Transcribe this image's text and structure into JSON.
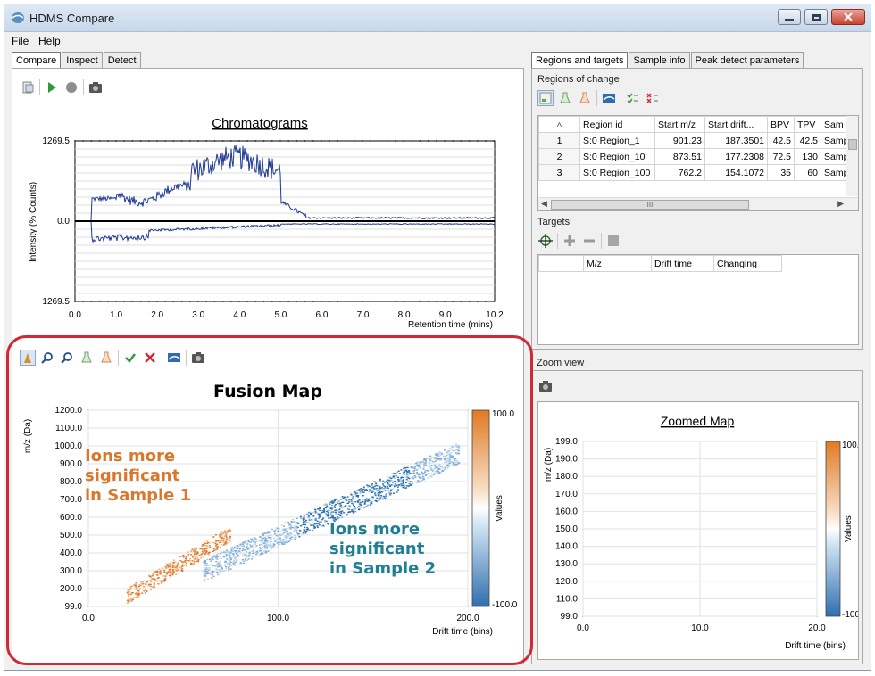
{
  "window": {
    "title": "HDMS Compare"
  },
  "menu": [
    "File",
    "Help"
  ],
  "left_tabs": [
    "Compare",
    "Inspect",
    "Detect"
  ],
  "right_tabs": [
    "Regions and targets",
    "Sample info",
    "Peak detect parameters"
  ],
  "chromatogram": {
    "title": "Chromatograms",
    "ylabel": "Intensity (% Counts)",
    "xlabel": "Retention time (mins)",
    "y_ticks": [
      "1269.5",
      "0.0",
      "1269.5"
    ],
    "x_ticks": [
      "0.0",
      "1.0",
      "2.0",
      "3.0",
      "4.0",
      "5.0",
      "6.0",
      "7.0",
      "8.0",
      "9.0",
      "10.2"
    ]
  },
  "fusion_map": {
    "title": "Fusion Map",
    "ylabel": "m/z (Da)",
    "xlabel": "Drift time (bins)",
    "y_ticks": [
      "1200.0",
      "1100.0",
      "1000.0",
      "900.0",
      "800.0",
      "700.0",
      "600.0",
      "500.0",
      "400.0",
      "300.0",
      "200.0",
      "99.0"
    ],
    "x_ticks": [
      "0.0",
      "100.0",
      "200.0"
    ],
    "colorbar": {
      "label": "Values",
      "max": "100.0",
      "min": "-100.0"
    }
  },
  "callouts": {
    "sample1": [
      "Ions more",
      "significant",
      "in Sample 1"
    ],
    "sample2": [
      "Ions more",
      "significant",
      "in Sample 2"
    ]
  },
  "regions": {
    "section_label": "Regions of change",
    "columns": [
      "Region id",
      "Start m/z",
      "Start drift...",
      "BPV",
      "TPV",
      "Sam"
    ],
    "rows": [
      {
        "n": "1",
        "id": "S:0 Region_1",
        "mz": "901.23",
        "drift": "187.3501",
        "bpv": "42.5",
        "tpv": "42.5",
        "sam": "Samp"
      },
      {
        "n": "2",
        "id": "S:0 Region_10",
        "mz": "873.51",
        "drift": "177.2308",
        "bpv": "72.5",
        "tpv": "130",
        "sam": "Samp"
      },
      {
        "n": "3",
        "id": "S:0 Region_100",
        "mz": "762.2",
        "drift": "154.1072",
        "bpv": "35",
        "tpv": "60",
        "sam": "Samp"
      }
    ],
    "hscroll_mark": "III"
  },
  "targets": {
    "section_label": "Targets",
    "columns": [
      "M/z",
      "Drift time",
      "Changing"
    ]
  },
  "zoom": {
    "section_label": "Zoom view",
    "title": "Zoomed Map",
    "ylabel": "m/z (Da)",
    "xlabel": "Drift time (bins)",
    "y_ticks": [
      "199.0",
      "190.0",
      "180.0",
      "170.0",
      "160.0",
      "150.0",
      "140.0",
      "130.0",
      "120.0",
      "110.0",
      "99.0"
    ],
    "x_ticks": [
      "0.0",
      "10.0",
      "20.0"
    ],
    "colorbar": {
      "label": "Values",
      "max": "100.",
      "min": "-100"
    }
  },
  "colors": {
    "orange": "#d9782d",
    "blue": "#3e7fb5",
    "teal": "#1f7f95",
    "trace": "#1f3a93",
    "highlight": "#d02834"
  }
}
